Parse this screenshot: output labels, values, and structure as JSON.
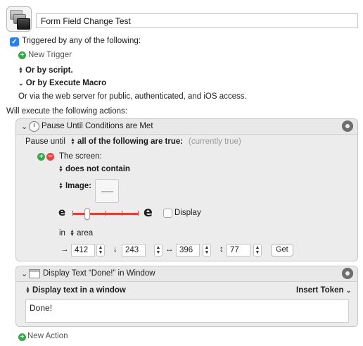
{
  "macro": {
    "name": "Form Field Change Test"
  },
  "triggers": {
    "checkbox_label": "Triggered by any of the following:",
    "new_trigger": "New Trigger",
    "or_by_script": "Or by script.",
    "or_by_execute_macro": "Or by Execute Macro",
    "web_server_note": "Or via the web server for public, authenticated, and iOS access."
  },
  "actions_header": "Will execute the following actions:",
  "action1": {
    "title": "Pause Until Conditions are Met",
    "pause_until_label": "Pause until",
    "condition_mode": "all of the following are true:",
    "status": "(currently true)",
    "screen_label": "The screen:",
    "contain_mode": "does not contain",
    "image_label": "Image:",
    "fuzz_min_glyph": "e",
    "fuzz_max_glyph": "e",
    "fuzz_level": 0.22,
    "display_label": "Display",
    "in_label": "in",
    "area_label": "area",
    "x_value": "412",
    "y_value": "243",
    "w_value": "396",
    "h_value": "77",
    "get_label": "Get",
    "arrow_x": "→",
    "arrow_y": "↓",
    "arrow_w": "↔",
    "arrow_h": "↕"
  },
  "action2": {
    "title": "Display Text “Done!” in Window",
    "display_mode": "Display text in a window",
    "insert_token": "Insert Token",
    "text": "Done!"
  },
  "new_action": "New Action"
}
